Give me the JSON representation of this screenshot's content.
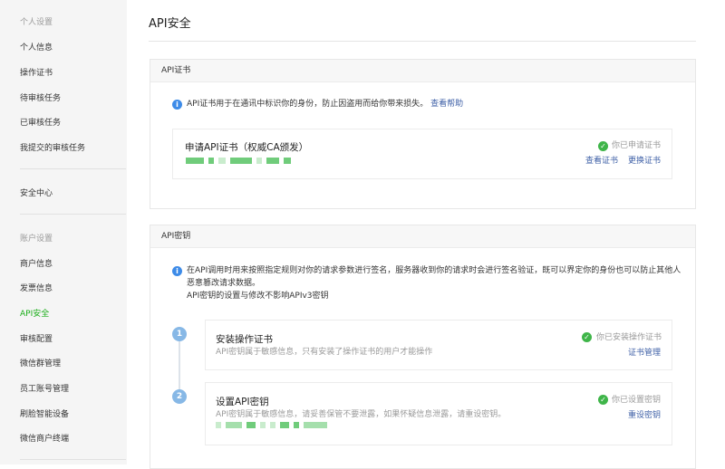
{
  "sidebar": {
    "personal_section": "个人设置",
    "personal_items": [
      "个人信息",
      "操作证书",
      "待审核任务",
      "已审核任务",
      "我提交的审核任务"
    ],
    "security_center": "安全中心",
    "account_section": "账户设置",
    "account_items": [
      "商户信息",
      "发票信息",
      "API安全",
      "审核配置",
      "微信群管理",
      "员工账号管理",
      "刷脸智能设备",
      "微信商户终端"
    ],
    "active": "API安全"
  },
  "page": {
    "title": "API安全"
  },
  "cert": {
    "header": "API证书",
    "info": "API证书用于在通讯中标识你的身份，防止因盗用而给你带来损失。",
    "help_link": "查看帮助",
    "card_title": "申请API证书（权威CA颁发）",
    "status": "你已申请证书",
    "view": "查看证书",
    "replace": "更换证书"
  },
  "key": {
    "header": "API密钥",
    "info1": "在API调用时用来按照指定规则对你的请求参数进行签名，服务器收到你的请求时会进行签名验证，既可以界定你的身份也可以防止其他人",
    "info2": "恶意篡改请求数据。",
    "info3": "API密钥的设置与修改不影响APIv3密钥",
    "steps": [
      {
        "num": "1",
        "title": "安装操作证书",
        "desc": "API密钥属于敏感信息，只有安装了操作证书的用户才能操作",
        "status": "你已安装操作证书",
        "action": "证书管理"
      },
      {
        "num": "2",
        "title": "设置API密钥",
        "desc": "API密钥属于敏感信息，请妥善保管不要泄露，如果怀疑信息泄露，请重设密钥。",
        "status": "你已设置密钥",
        "action": "重设密钥"
      }
    ]
  },
  "colors": {
    "accent": "#1aad19",
    "link": "#3d5fa6",
    "info": "#3d8be8",
    "ok": "#3fb549"
  }
}
